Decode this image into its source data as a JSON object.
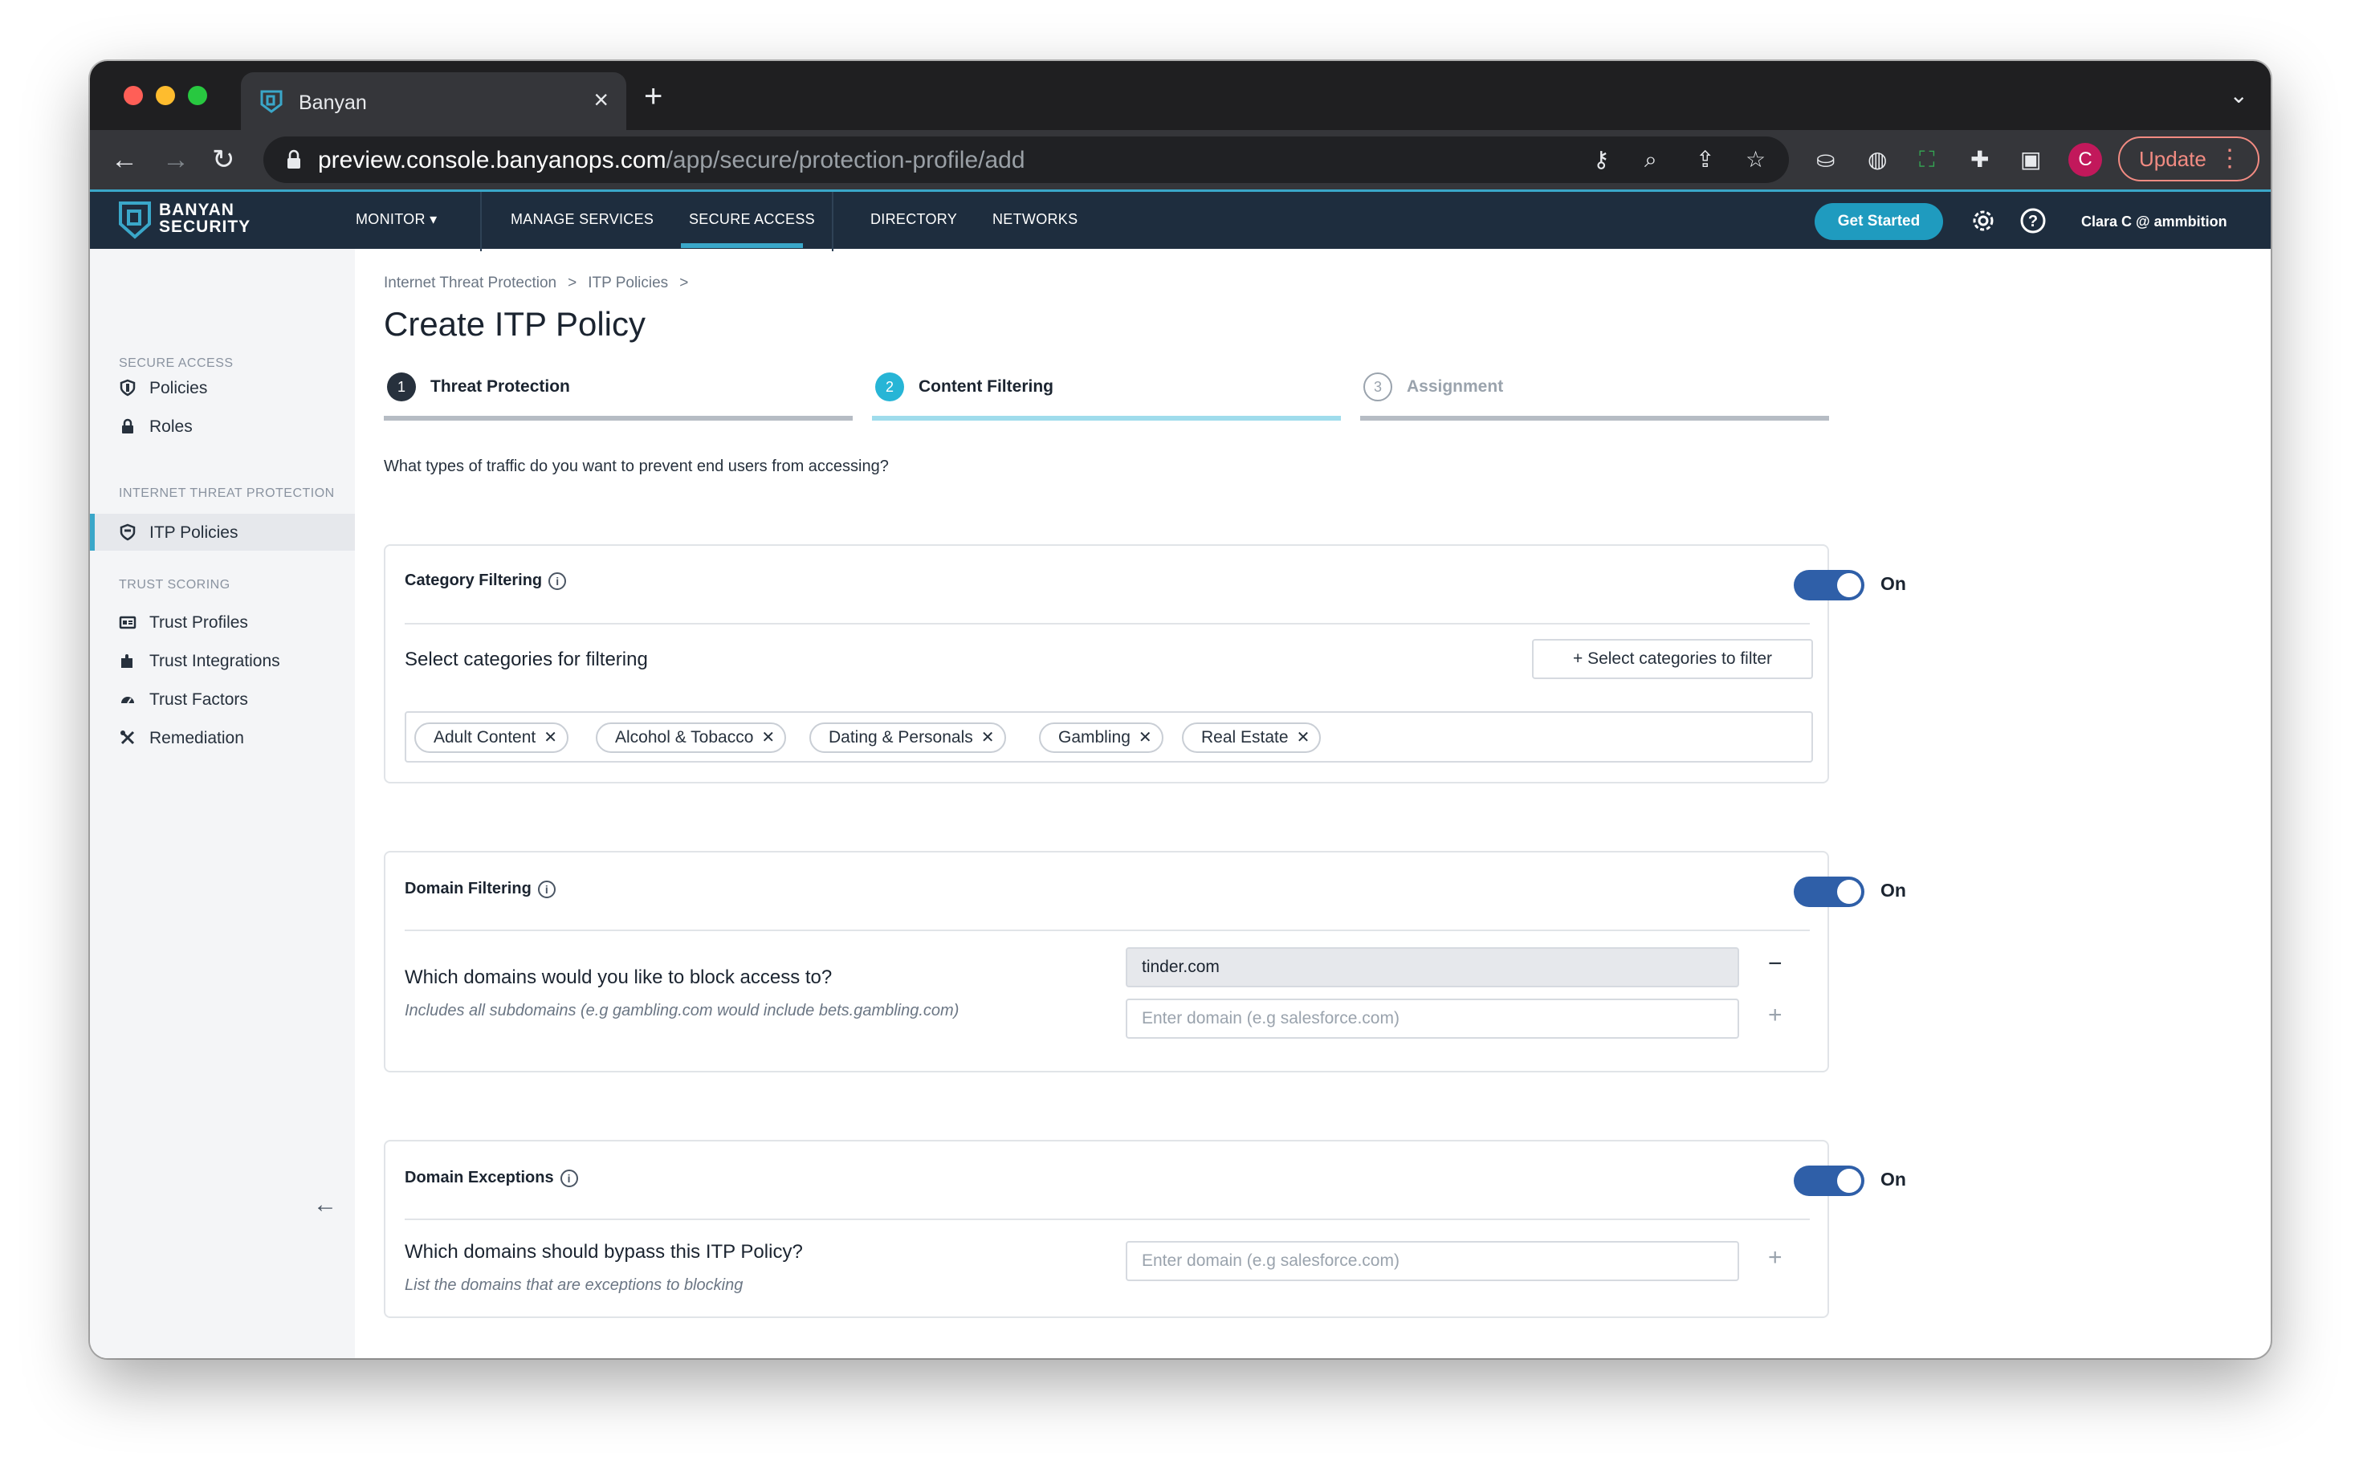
{
  "browser": {
    "tab_title": "Banyan",
    "url_host": "preview.console.banyanops.com",
    "url_path": "/app/secure/protection-profile/add",
    "profile_initial": "C",
    "update_label": "Update"
  },
  "header": {
    "logo_line1": "BANYAN",
    "logo_line2": "SECURITY",
    "nav": {
      "monitor": "MONITOR",
      "manage_services": "MANAGE SERVICES",
      "secure_access": "SECURE ACCESS",
      "directory": "DIRECTORY",
      "networks": "NETWORKS"
    },
    "get_started": "Get Started",
    "user": "Clara C @ ammbition"
  },
  "sidebar": {
    "sections": [
      {
        "title": "SECURE ACCESS",
        "items": [
          {
            "label": "Policies",
            "icon": "shield-icon"
          },
          {
            "label": "Roles",
            "icon": "lock-icon"
          }
        ]
      },
      {
        "title": "INTERNET THREAT PROTECTION",
        "items": [
          {
            "label": "ITP Policies",
            "icon": "shield-icon",
            "active": true
          }
        ]
      },
      {
        "title": "TRUST SCORING",
        "items": [
          {
            "label": "Trust Profiles",
            "icon": "id-card-icon"
          },
          {
            "label": "Trust Integrations",
            "icon": "puzzle-icon"
          },
          {
            "label": "Trust Factors",
            "icon": "gauge-icon"
          },
          {
            "label": "Remediation",
            "icon": "tools-icon"
          }
        ]
      }
    ]
  },
  "breadcrumb": [
    "Internet Threat Protection",
    ">",
    "ITP Policies",
    ">"
  ],
  "page_title": "Create ITP Policy",
  "steps": [
    {
      "num": "1",
      "label": "Threat Protection",
      "state": "done"
    },
    {
      "num": "2",
      "label": "Content Filtering",
      "state": "active"
    },
    {
      "num": "3",
      "label": "Assignment",
      "state": "pending"
    }
  ],
  "question": "What types of traffic do you want to prevent end users from accessing?",
  "category_filtering": {
    "title": "Category Filtering",
    "toggle_label": "On",
    "row_title": "Select categories for filtering",
    "select_button": "Select categories to filter",
    "chips": [
      "Adult Content",
      "Alcohol & Tobacco",
      "Dating & Personals",
      "Gambling",
      "Real Estate"
    ]
  },
  "domain_filtering": {
    "title": "Domain Filtering",
    "toggle_label": "On",
    "row_title": "Which domains would you like to block access to?",
    "row_sub": "Includes all subdomains (e.g gambling.com would include bets.gambling.com)",
    "domain_value": "tinder.com",
    "placeholder": "Enter domain (e.g salesforce.com)"
  },
  "domain_exceptions": {
    "title": "Domain Exceptions",
    "toggle_label": "On",
    "row_title": "Which domains should bypass this ITP Policy?",
    "row_sub": "List the domains that are exceptions to blocking",
    "placeholder": "Enter domain (e.g salesforce.com)"
  },
  "colors": {
    "accent": "#3aa7c9",
    "header_bg": "#1e2d3e",
    "toggle_on": "#2f5fa8",
    "get_started": "#1f9bbf"
  }
}
